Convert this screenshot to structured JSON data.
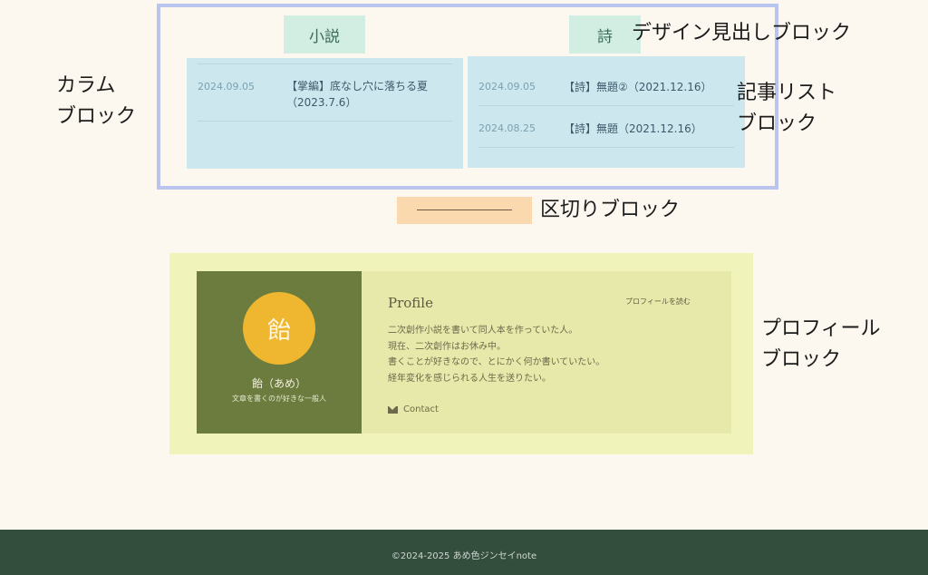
{
  "column_block": {
    "left_heading": "小説",
    "right_heading": "詩",
    "left_list": [
      {
        "date": "2024.09.05",
        "title": "【掌編】底なし穴に落ちる夏（2023.7.6）"
      }
    ],
    "right_list": [
      {
        "date": "2024.09.05",
        "title": "【詩】無題②（2021.12.16）"
      },
      {
        "date": "2024.08.25",
        "title": "【詩】無題（2021.12.16）"
      }
    ]
  },
  "annotations": {
    "column": [
      "カラム",
      "ブロック"
    ],
    "design_heading": "デザイン見出しブロック",
    "article_list": [
      "記事リスト",
      "ブロック"
    ],
    "separator": "区切りブロック",
    "profile": [
      "プロフィール",
      "ブロック"
    ]
  },
  "profile": {
    "avatar_char": "飴",
    "name": "飴（あめ）",
    "tagline": "文章を書くのが好きな一般人",
    "title": "Profile",
    "read_more": "プロフィールを読む",
    "bio": [
      "二次創作小説を書いて同人本を作っていた人。",
      "現在、二次創作はお休み中。",
      "書くことが好きなので、とにかく何か書いていたい。",
      "経年変化を感じられる人生を送りたい。"
    ],
    "contact": "Contact"
  },
  "footer": {
    "copyright": "©2024-2025  あめ色ジンセイnote"
  },
  "colors": {
    "background": "#fcf7ef",
    "frame": "#b9c5ee",
    "list_bg": "#cde7ef",
    "heading_bg": "#d2eee2",
    "separator_bg": "#f9d9ad",
    "profile_outer": "#f0f4ba",
    "profile_left": "#6b7c3e",
    "avatar": "#efb72f",
    "footer": "#344e3e"
  }
}
